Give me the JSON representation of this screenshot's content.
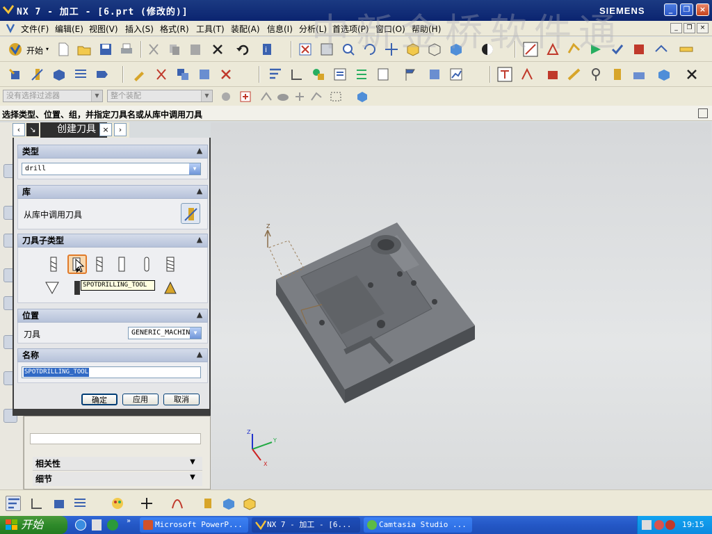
{
  "window": {
    "title": "NX 7 - 加工 - [6.prt (修改的)]",
    "brand": "SIEMENS",
    "watermark": "中新金桥软件通"
  },
  "menu": [
    "文件(F)",
    "编辑(E)",
    "视图(V)",
    "插入(S)",
    "格式(R)",
    "工具(T)",
    "装配(A)",
    "信息(I)",
    "分析(L)",
    "首选项(P)",
    "窗口(O)",
    "帮助(H)"
  ],
  "toolbar1": {
    "start_label": "开始"
  },
  "filter": {
    "type_filter": "没有选择过滤器",
    "scope": "整个装配"
  },
  "cue": "选择类型、位置、组，并指定刀具名或从库中调用刀具",
  "dialog": {
    "title": "创建刀具",
    "sections": {
      "type": {
        "label": "类型",
        "value": "drill"
      },
      "library": {
        "label": "库",
        "retrieve": "从库中调用刀具"
      },
      "subtype": {
        "label": "刀具子类型",
        "tooltip": "SPOTDRILLING_TOOL"
      },
      "location": {
        "label": "位置",
        "tool_label": "刀具",
        "tool_value": "GENERIC_MACHINE"
      },
      "name": {
        "label": "名称",
        "value": "SPOTDRILLING_TOOL"
      }
    },
    "buttons": {
      "ok": "确定",
      "apply": "应用",
      "cancel": "取消"
    }
  },
  "navigator": {
    "sections": [
      "相关性",
      "细节"
    ]
  },
  "axes": {
    "x": "X",
    "y": "Y",
    "z": "Z"
  },
  "taskbar": {
    "start": "开始",
    "tasks": [
      "Microsoft PowerP...",
      "NX 7 - 加工 - [6...",
      "Camtasia Studio ..."
    ],
    "clock": "19:15"
  },
  "colors": {
    "accent": "#2457c6",
    "dialog_header": "#2f2f2f",
    "part": "#6a6d72"
  }
}
